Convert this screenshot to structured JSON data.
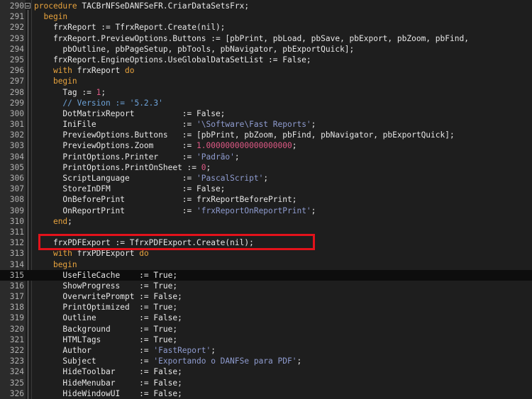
{
  "editor": {
    "header": {
      "ln": "290",
      "code": [
        [
          "kw",
          "procedure"
        ],
        [
          "",
          " TACBrNFSeDANFSeFR.CriarDataSetsFrx;"
        ]
      ]
    },
    "lines": [
      {
        "ln": "291",
        "code": [
          [
            "",
            "  "
          ],
          [
            "kw",
            "begin"
          ]
        ]
      },
      {
        "ln": "292",
        "code": [
          [
            "",
            "    frxReport := TfrxReport.Create(nil);"
          ]
        ]
      },
      {
        "ln": "293",
        "code": [
          [
            "",
            "    frxReport.PreviewOptions.Buttons := [pbPrint, pbLoad, pbSave, pbExport, pbZoom, pbFind,"
          ]
        ]
      },
      {
        "ln": "294",
        "code": [
          [
            "",
            "      pbOutline, pbPageSetup, pbTools, pbNavigator, pbExportQuick];"
          ]
        ]
      },
      {
        "ln": "295",
        "code": [
          [
            "",
            "    frxReport.EngineOptions.UseGlobalDataSetList := False;"
          ]
        ]
      },
      {
        "ln": "296",
        "code": [
          [
            "",
            "    "
          ],
          [
            "kw",
            "with"
          ],
          [
            "",
            " frxReport "
          ],
          [
            "kw",
            "do"
          ]
        ]
      },
      {
        "ln": "297",
        "code": [
          [
            "",
            "    "
          ],
          [
            "kw",
            "begin"
          ]
        ]
      },
      {
        "ln": "298",
        "code": [
          [
            "",
            "      Tag := "
          ],
          [
            "nm",
            "1"
          ],
          [
            "",
            ";"
          ]
        ]
      },
      {
        "ln": "299",
        "code": [
          [
            "",
            "      "
          ],
          [
            "cm",
            "// Version := '5.2.3'"
          ]
        ]
      },
      {
        "ln": "300",
        "code": [
          [
            "",
            "      DotMatrixReport          := False;"
          ]
        ]
      },
      {
        "ln": "301",
        "code": [
          [
            "",
            "      IniFile                  := "
          ],
          [
            "st",
            "'\\Software\\Fast Reports'"
          ],
          [
            "",
            ";"
          ]
        ]
      },
      {
        "ln": "302",
        "code": [
          [
            "",
            "      PreviewOptions.Buttons   := [pbPrint, pbZoom, pbFind, pbNavigator, pbExportQuick];"
          ]
        ]
      },
      {
        "ln": "303",
        "code": [
          [
            "",
            "      PreviewOptions.Zoom      := "
          ],
          [
            "nm",
            "1.000000000000000000"
          ],
          [
            "",
            ";"
          ]
        ]
      },
      {
        "ln": "304",
        "code": [
          [
            "",
            "      PrintOptions.Printer     := "
          ],
          [
            "st",
            "'Padrão'"
          ],
          [
            "",
            ";"
          ]
        ]
      },
      {
        "ln": "305",
        "code": [
          [
            "",
            "      PrintOptions.PrintOnSheet := "
          ],
          [
            "nm",
            "0"
          ],
          [
            "",
            ";"
          ]
        ]
      },
      {
        "ln": "306",
        "code": [
          [
            "",
            "      ScriptLanguage           := "
          ],
          [
            "st",
            "'PascalScript'"
          ],
          [
            "",
            ";"
          ]
        ]
      },
      {
        "ln": "307",
        "code": [
          [
            "",
            "      StoreInDFM               := False;"
          ]
        ]
      },
      {
        "ln": "308",
        "code": [
          [
            "",
            "      OnBeforePrint            := frxReportBeforePrint;"
          ]
        ]
      },
      {
        "ln": "309",
        "code": [
          [
            "",
            "      OnReportPrint            := "
          ],
          [
            "st",
            "'frxReportOnReportPrint'"
          ],
          [
            "",
            ";"
          ]
        ]
      },
      {
        "ln": "310",
        "code": [
          [
            "",
            "    "
          ],
          [
            "kw",
            "end"
          ],
          [
            "",
            ";"
          ]
        ]
      },
      {
        "ln": "311",
        "code": [
          [
            "",
            ""
          ]
        ]
      },
      {
        "ln": "312",
        "code": [
          [
            "",
            "    frxPDFExport := TfrxPDFExport.Create(nil);"
          ]
        ]
      },
      {
        "ln": "313",
        "code": [
          [
            "",
            "    "
          ],
          [
            "kw",
            "with"
          ],
          [
            "",
            " frxPDFExport "
          ],
          [
            "kw",
            "do"
          ]
        ]
      },
      {
        "ln": "314",
        "code": [
          [
            "",
            "    "
          ],
          [
            "kw",
            "begin"
          ]
        ]
      },
      {
        "ln": "315",
        "code": [
          [
            "",
            "      UseFileCache    := True;"
          ]
        ],
        "current": true
      },
      {
        "ln": "316",
        "code": [
          [
            "",
            "      ShowProgress    := True;"
          ]
        ]
      },
      {
        "ln": "317",
        "code": [
          [
            "",
            "      OverwritePrompt := False;"
          ]
        ]
      },
      {
        "ln": "318",
        "code": [
          [
            "",
            "      PrintOptimized  := True;"
          ]
        ]
      },
      {
        "ln": "319",
        "code": [
          [
            "",
            "      Outline         := False;"
          ]
        ]
      },
      {
        "ln": "320",
        "code": [
          [
            "",
            "      Background      := True;"
          ]
        ]
      },
      {
        "ln": "321",
        "code": [
          [
            "",
            "      HTMLTags        := True;"
          ]
        ]
      },
      {
        "ln": "322",
        "code": [
          [
            "",
            "      Author          := "
          ],
          [
            "st",
            "'FastReport'"
          ],
          [
            "",
            ";"
          ]
        ]
      },
      {
        "ln": "323",
        "code": [
          [
            "",
            "      Subject         := "
          ],
          [
            "st",
            "'Exportando o DANFSe para PDF'"
          ],
          [
            "",
            ";"
          ]
        ]
      },
      {
        "ln": "324",
        "code": [
          [
            "",
            "      HideToolbar     := False;"
          ]
        ]
      },
      {
        "ln": "325",
        "code": [
          [
            "",
            "      HideMenubar     := False;"
          ]
        ]
      },
      {
        "ln": "326",
        "code": [
          [
            "",
            "      HideWindowUI    := False;"
          ]
        ]
      }
    ]
  },
  "colors": {
    "keyword": "#e8a33d",
    "string": "#8f9cd0",
    "number": "#e05a86",
    "comment": "#6ea3d9",
    "highlight_box": "#e3121b"
  }
}
